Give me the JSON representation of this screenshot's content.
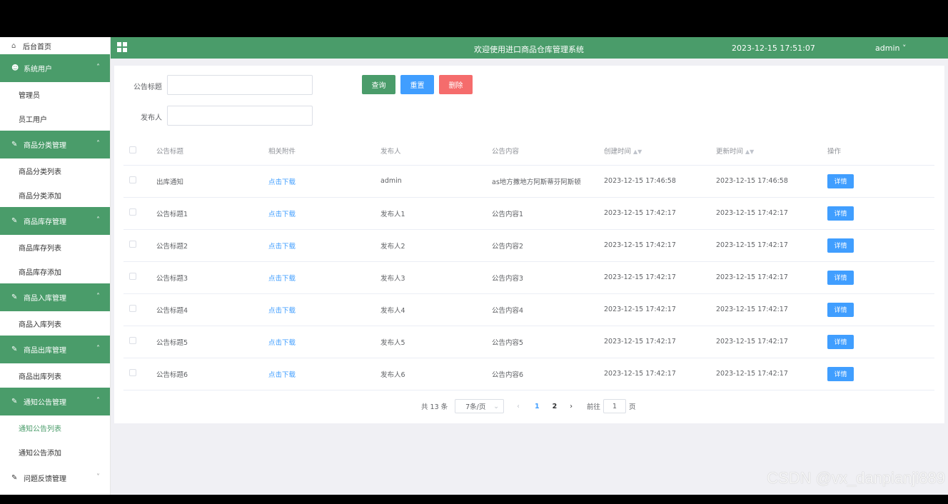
{
  "colors": {
    "brand": "#4a9c6a",
    "primary": "#409eff",
    "danger": "#f56c6c"
  },
  "sidebar": {
    "home_label": "后台首页",
    "groups": [
      {
        "title": "系统用户",
        "icon": "user-icon",
        "items": [
          "管理员",
          "员工用户"
        ]
      },
      {
        "title": "商品分类管理",
        "icon": "edit-icon",
        "items": [
          "商品分类列表",
          "商品分类添加"
        ]
      },
      {
        "title": "商品库存管理",
        "icon": "edit-icon",
        "items": [
          "商品库存列表",
          "商品库存添加"
        ]
      },
      {
        "title": "商品入库管理",
        "icon": "edit-icon",
        "items": [
          "商品入库列表"
        ]
      },
      {
        "title": "商品出库管理",
        "icon": "edit-icon",
        "items": [
          "商品出库列表"
        ]
      },
      {
        "title": "通知公告管理",
        "icon": "edit-icon",
        "items": [
          "通知公告列表",
          "通知公告添加"
        ]
      }
    ],
    "collapsed_group": "问题反馈管理"
  },
  "header": {
    "title": "欢迎使用进口商品仓库管理系统",
    "datetime": "2023-12-15 17:51:07",
    "user": "admin"
  },
  "search": {
    "title_label": "公告标题",
    "title_value": "",
    "publisher_label": "发布人",
    "publisher_value": "",
    "query_btn": "查询",
    "reset_btn": "重置",
    "delete_btn": "删除"
  },
  "table": {
    "columns": [
      "公告标题",
      "相关附件",
      "发布人",
      "公告内容",
      "创建时间",
      "更新时间",
      "操作"
    ],
    "rows": [
      [
        "出库通知",
        "点击下载",
        "admin",
        "as地方撒地方阿斯蒂芬阿斯顿",
        "2023-12-15 17:46:58",
        "2023-12-15 17:46:58",
        "详情"
      ],
      [
        "公告标题1",
        "点击下载",
        "发布人1",
        "公告内容1",
        "2023-12-15 17:42:17",
        "2023-12-15 17:42:17",
        "详情"
      ],
      [
        "公告标题2",
        "点击下载",
        "发布人2",
        "公告内容2",
        "2023-12-15 17:42:17",
        "2023-12-15 17:42:17",
        "详情"
      ],
      [
        "公告标题3",
        "点击下载",
        "发布人3",
        "公告内容3",
        "2023-12-15 17:42:17",
        "2023-12-15 17:42:17",
        "详情"
      ],
      [
        "公告标题4",
        "点击下载",
        "发布人4",
        "公告内容4",
        "2023-12-15 17:42:17",
        "2023-12-15 17:42:17",
        "详情"
      ],
      [
        "公告标题5",
        "点击下载",
        "发布人5",
        "公告内容5",
        "2023-12-15 17:42:17",
        "2023-12-15 17:42:17",
        "详情"
      ],
      [
        "公告标题6",
        "点击下载",
        "发布人6",
        "公告内容6",
        "2023-12-15 17:42:17",
        "2023-12-15 17:42:17",
        "详情"
      ]
    ]
  },
  "pager": {
    "total": "共 13 条",
    "page_size": "7条/页",
    "pages": [
      "1",
      "2"
    ],
    "current": "1",
    "goto_label": "前往",
    "goto_value": "1",
    "page_unit": "页"
  },
  "watermark": "CSDN @vx_danpianji889"
}
